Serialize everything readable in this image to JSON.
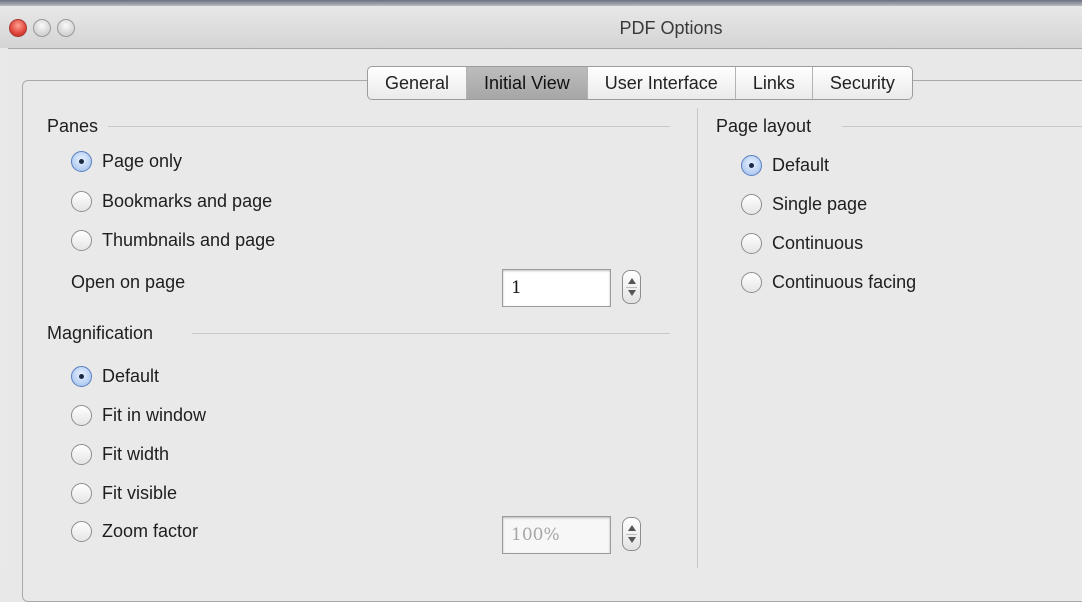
{
  "window": {
    "title": "PDF Options"
  },
  "tabs": [
    "General",
    "Initial View",
    "User Interface",
    "Links",
    "Security"
  ],
  "active_tab": "Initial View",
  "panes": {
    "label": "Panes",
    "options": [
      "Page only",
      "Bookmarks and page",
      "Thumbnails and page"
    ],
    "selected": "Page only",
    "open_on_page_label": "Open on page",
    "open_on_page_value": "1"
  },
  "magnification": {
    "label": "Magnification",
    "options": [
      "Default",
      "Fit in window",
      "Fit width",
      "Fit visible",
      "Zoom factor"
    ],
    "selected": "Default",
    "zoom_value": "100%"
  },
  "page_layout": {
    "label": "Page layout",
    "options": [
      "Default",
      "Single page",
      "Continuous",
      "Continuous facing"
    ],
    "selected": "Default"
  }
}
